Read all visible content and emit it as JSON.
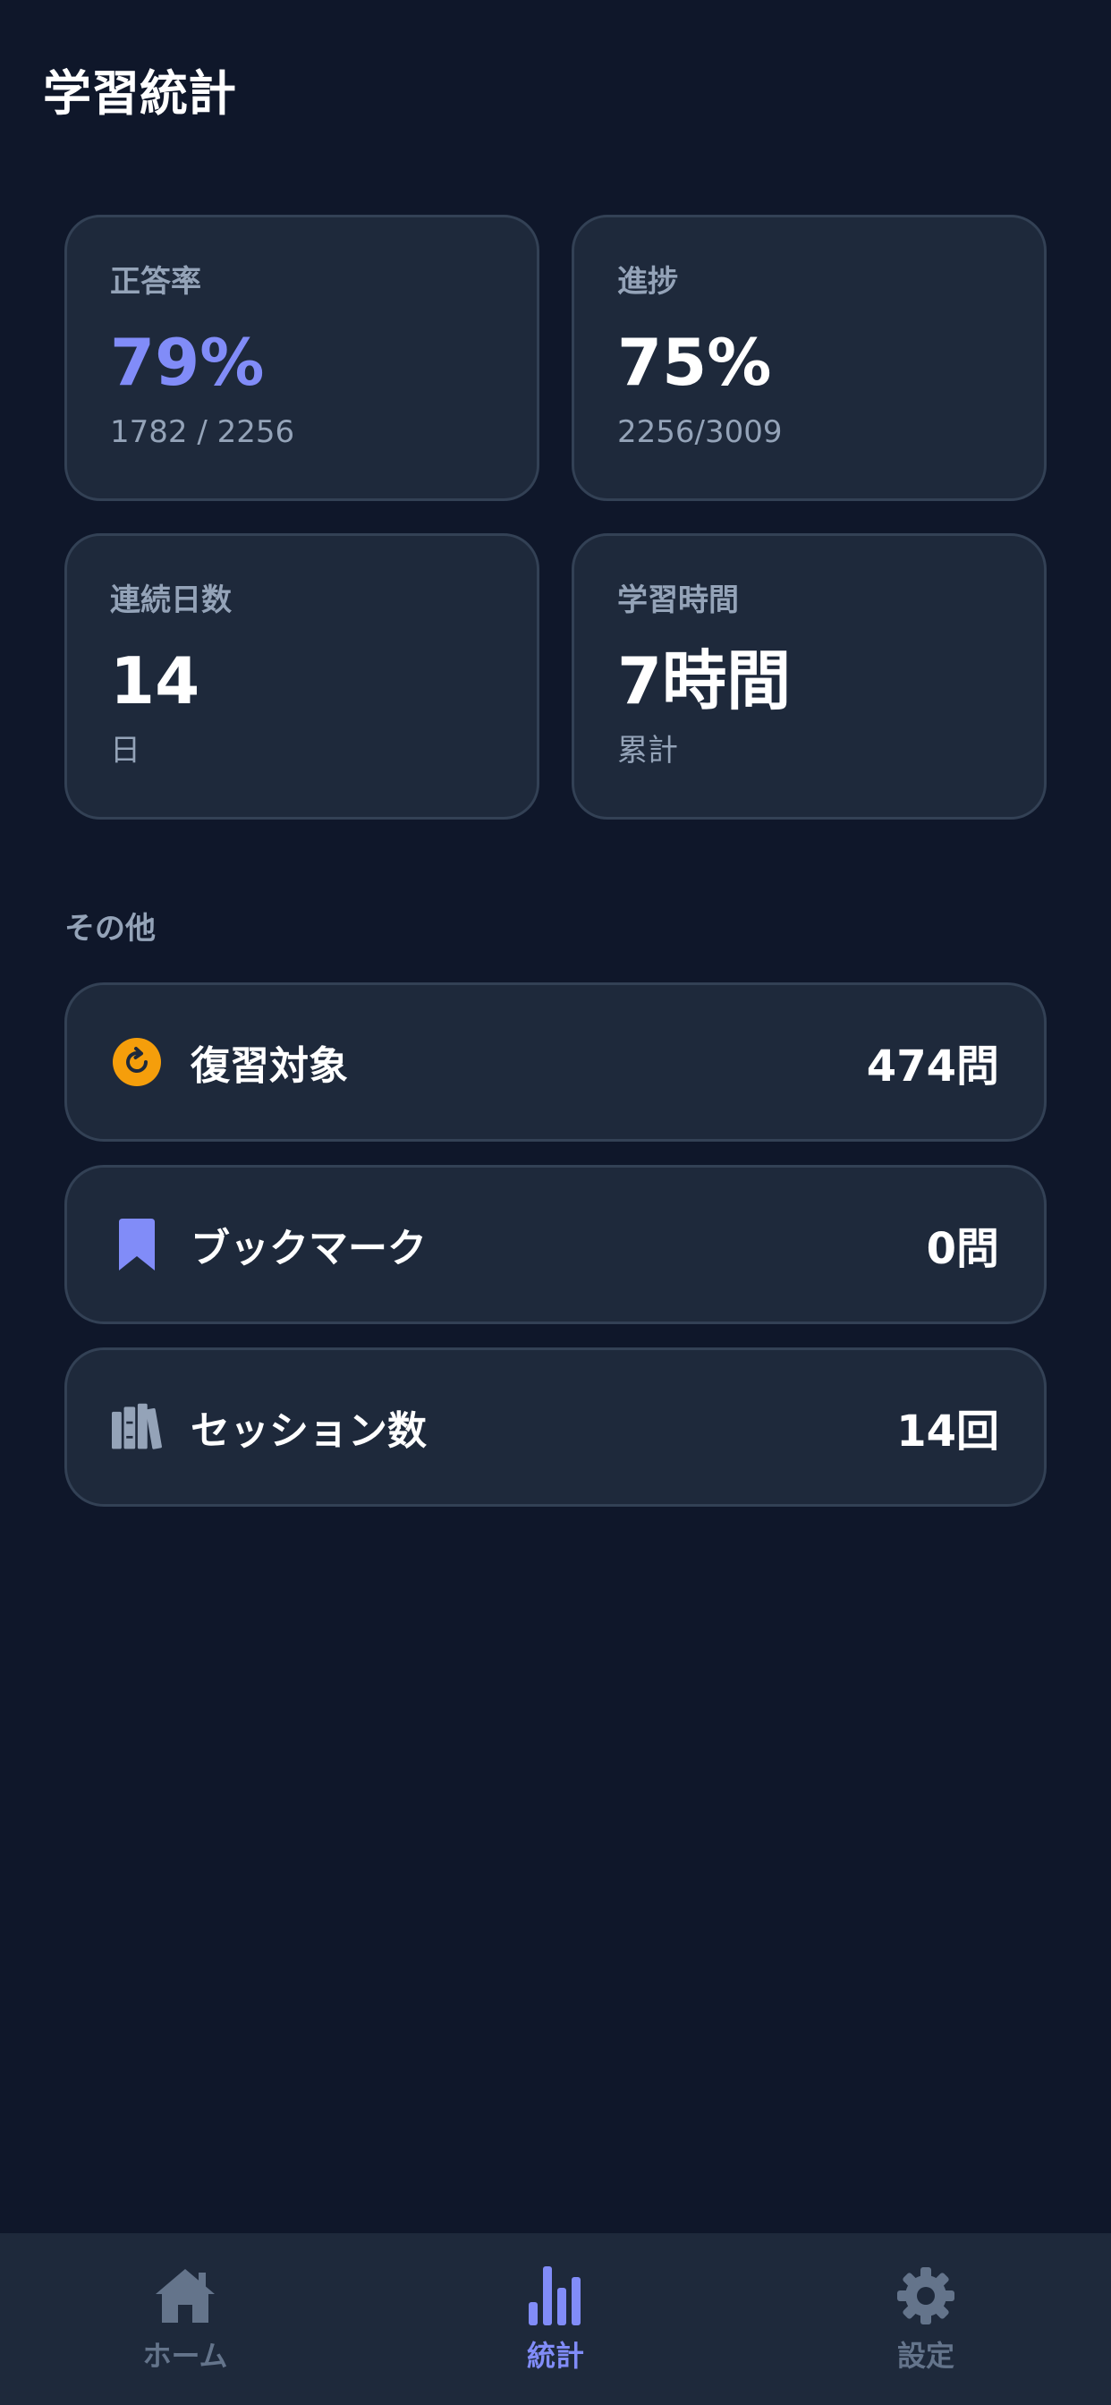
{
  "header": {
    "title": "学習統計"
  },
  "stats": [
    {
      "label": "正答率",
      "value": "79%",
      "sub": "1782 / 2256",
      "accent": "#818cf8"
    },
    {
      "label": "進捗",
      "value": "75%",
      "sub": "2256/3009"
    },
    {
      "label": "連続日数",
      "value": "14",
      "sub": "日"
    },
    {
      "label": "学習時間",
      "value": "7時間",
      "sub": "累計"
    }
  ],
  "other": {
    "heading": "その他",
    "items": [
      {
        "icon": "review-refresh-icon",
        "label": "復習対象",
        "value": "474問",
        "icon_color": "#f59e0b"
      },
      {
        "icon": "bookmark-icon",
        "label": "ブックマーク",
        "value": "0問",
        "icon_color": "#818cf8"
      },
      {
        "icon": "books-icon",
        "label": "セッション数",
        "value": "14回",
        "icon_color": "#94a3b8"
      }
    ]
  },
  "tabbar": {
    "tabs": [
      {
        "icon": "home-icon",
        "label": "ホーム",
        "active": false
      },
      {
        "icon": "bar-chart-icon",
        "label": "統計",
        "active": true
      },
      {
        "icon": "gear-icon",
        "label": "設定",
        "active": false
      }
    ]
  },
  "colors": {
    "background": "#0f172a",
    "card": "#1e293b",
    "border": "#334155",
    "muted": "#94a3b8",
    "accent": "#818cf8",
    "inactive_tab": "#64748b"
  }
}
